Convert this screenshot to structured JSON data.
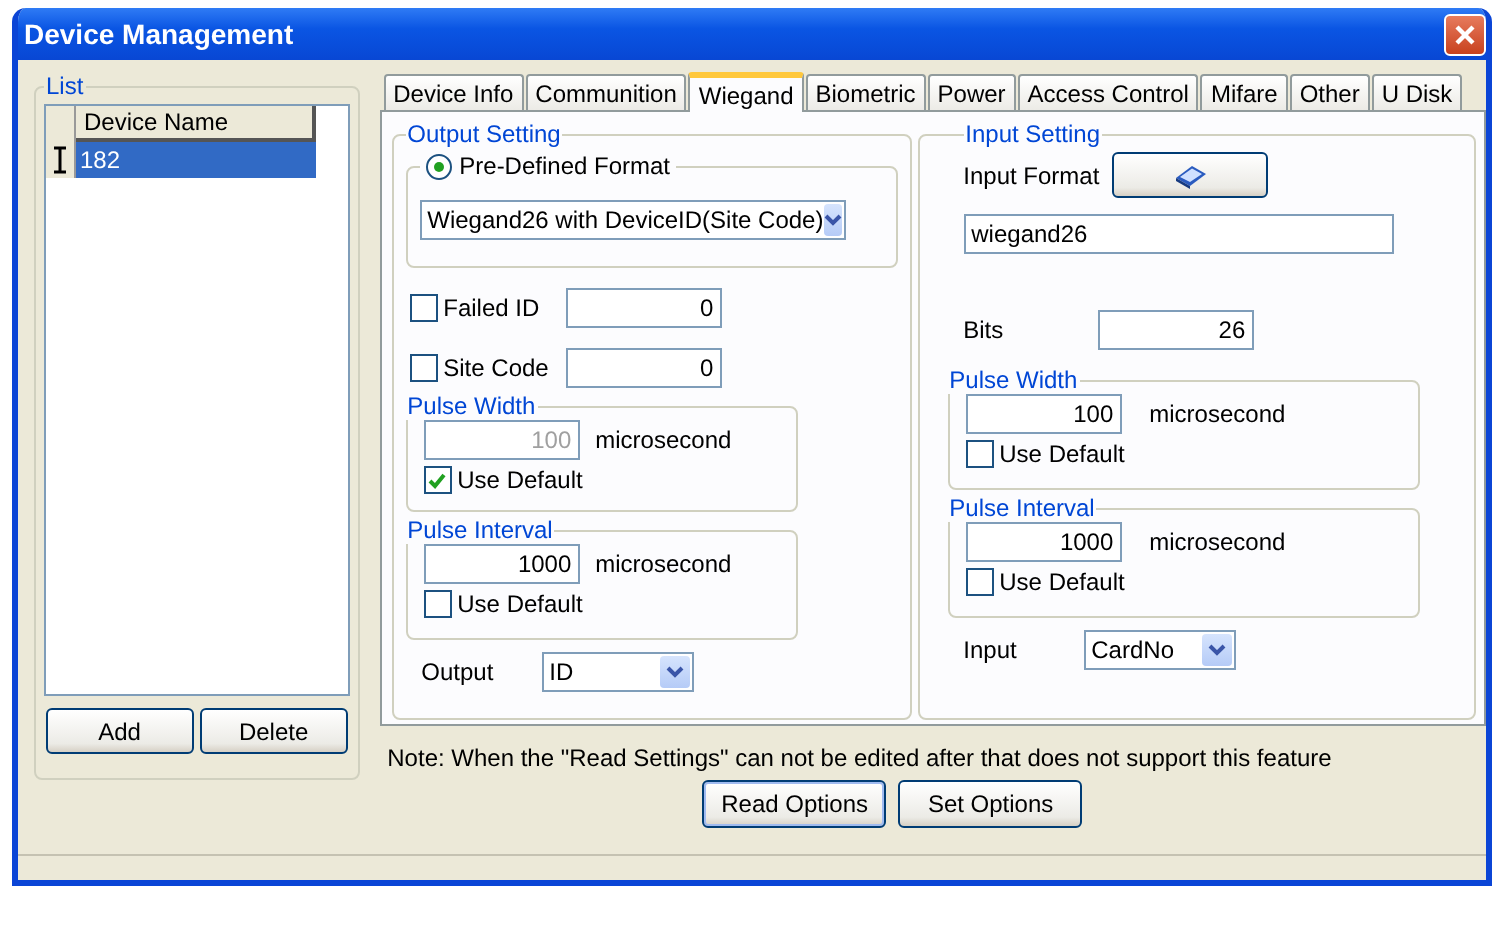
{
  "window": {
    "title": "Device Management"
  },
  "list": {
    "title": "List",
    "columns": [
      "Device Name"
    ],
    "rows": [
      {
        "cells": [
          "182"
        ],
        "selected": true
      }
    ],
    "buttons": [
      "Add",
      "Delete"
    ]
  },
  "tabs": [
    {
      "label": "Device Info",
      "selected": false
    },
    {
      "label": "Communition",
      "selected": false
    },
    {
      "label": "Wiegand",
      "selected": true
    },
    {
      "label": "Biometric",
      "selected": false
    },
    {
      "label": "Power",
      "selected": false
    },
    {
      "label": "Access Control",
      "selected": false
    },
    {
      "label": "Mifare",
      "selected": false
    },
    {
      "label": "Other",
      "selected": false
    },
    {
      "label": "U Disk",
      "selected": false
    }
  ],
  "output_setting": {
    "title": "Output Setting",
    "format_option": {
      "label": "Pre-Defined Format",
      "selected": true
    },
    "format_select": {
      "value": "Wiegand26 with DeviceID(Site Code)"
    },
    "failed_id": {
      "label": "Failed ID",
      "checked": false,
      "value": "0"
    },
    "site_code": {
      "label": "Site Code",
      "checked": false,
      "value": "0"
    },
    "pulse_width": {
      "title": "Pulse Width",
      "value": "100",
      "unit": "microsecond",
      "disabled": true,
      "use_default": {
        "label": "Use Default",
        "checked": true
      }
    },
    "pulse_interval": {
      "title": "Pulse Interval",
      "value": "1000",
      "unit": "microsecond",
      "disabled": false,
      "use_default": {
        "label": "Use Default",
        "checked": false
      }
    },
    "output": {
      "label": "Output",
      "value": "ID"
    }
  },
  "input_setting": {
    "title": "Input Setting",
    "input_format_label": "Input Format",
    "format_value": "wiegand26",
    "bits": {
      "label": "Bits",
      "value": "26"
    },
    "pulse_width": {
      "title": "Pulse Width",
      "value": "100",
      "unit": "microsecond",
      "disabled": false,
      "use_default": {
        "label": "Use Default",
        "checked": false
      }
    },
    "pulse_interval": {
      "title": "Pulse Interval",
      "value": "1000",
      "unit": "microsecond",
      "disabled": false,
      "use_default": {
        "label": "Use Default",
        "checked": false
      }
    },
    "input": {
      "label": "Input",
      "value": "CardNo"
    }
  },
  "note": "Note: When the \"Read Settings\" can not be edited after that does not support this feature",
  "actions": [
    "Read Options",
    "Set Options"
  ]
}
